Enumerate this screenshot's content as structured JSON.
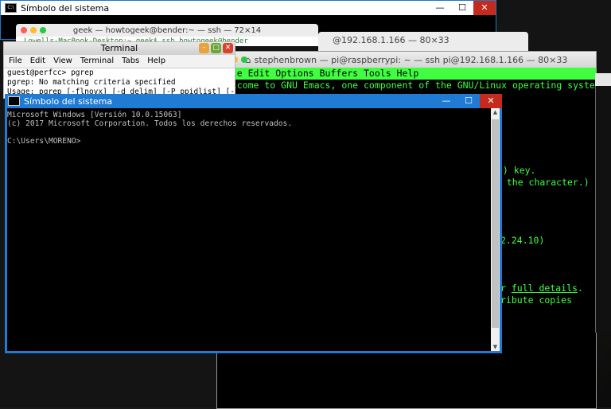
{
  "cmd_back": {
    "title": "Símbolo del sistema",
    "title_suffix": "[Versión 10.0.15063]"
  },
  "ssh_back": {
    "title": "geek — howtogeek@bender:~ — ssh — 72×14",
    "line": "Lowells-MacBook-Desktop:~ geek$ ssh howtogeek@bender"
  },
  "ssh_back2": {
    "title": "@192.168.1.166 — 80×33"
  },
  "terminal": {
    "title": "Terminal",
    "menu": [
      "File",
      "Edit",
      "View",
      "Terminal",
      "Tabs",
      "Help"
    ],
    "lines": [
      "guest@perfcc> pgrep",
      "pgrep: No matching criteria specified",
      "Usage: pgrep [-flnovx] [-d delim] [-P ppidlist] [-g"
    ]
  },
  "emacs": {
    "title": "stephenbrown — pi@raspberrypi: ~ — ssh pi@192.168.1.166 — 80×33",
    "menubar": "File Edit Options Buffers Tools Help",
    "welcome": "Welcome to GNU Emacs, one component of the GNU/Linux operating system.",
    "fragments": {
      "f1": "t) key.",
      "f2": "y the character.)",
      "f3": "2.24.10)",
      "f4_prefix": "r ",
      "f4_link": "full details",
      "f4_suffix": ".",
      "f5": "ribute copies"
    }
  },
  "cmd_front": {
    "title": "Símbolo del sistema",
    "lines": [
      "Microsoft Windows [Versión 10.0.15063]",
      "(c) 2017 Microsoft Corporation. Todos los derechos reservados.",
      "",
      "C:\\Users\\MORENO>"
    ]
  },
  "window_controls": {
    "minimize": "—",
    "maximize": "☐",
    "close": "✕"
  },
  "colors": {
    "win_accent": "#1f7bd4",
    "emacs_green": "#40ff40",
    "console_text": "#c0c0c0"
  }
}
